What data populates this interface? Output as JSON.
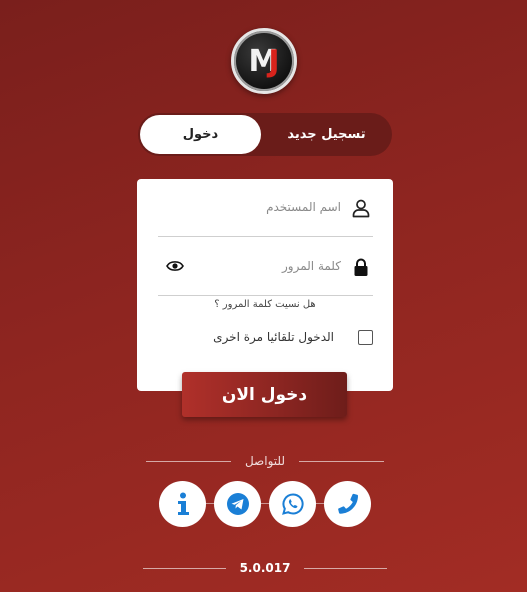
{
  "logo": {
    "letter_1": "M",
    "letter_2": "J"
  },
  "tabs": {
    "login": "دخول",
    "register": "تسجيل جديد"
  },
  "form": {
    "username_placeholder": "اسم المستخدم",
    "password_placeholder": "كلمة المرور",
    "forgot_password": "هل نسيت كلمة المرور ؟",
    "remember_me": "الدخول تلقائيا مرة اخرى",
    "remember_checked": false
  },
  "login_button": "دخول الان",
  "contact_label": "للتواصل",
  "social_icons": [
    "info-icon",
    "telegram-icon",
    "whatsapp-icon",
    "phone-icon"
  ],
  "version": "5.0.017",
  "colors": {
    "accent": "#8e2520",
    "icon_blue": "#1a7fd6"
  }
}
